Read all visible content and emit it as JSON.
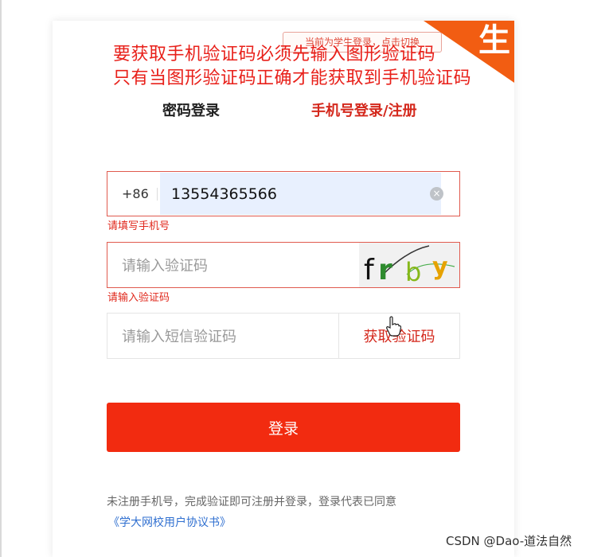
{
  "role_switch": {
    "text": "当前为学生登录，点击切换"
  },
  "corner_badge": {
    "text": "生",
    "color": "#f25d12"
  },
  "annotation": {
    "line1": "要获取手机验证码必须先输入图形验证码",
    "line2": "只有当图形验证码正确才能获取到手机验证码"
  },
  "tabs": {
    "password_login": "密码登录",
    "phone_login": "手机号登录/注册"
  },
  "phone_field": {
    "country_code": "+86",
    "value": "13554365566",
    "error": "请填写手机号"
  },
  "captcha_field": {
    "placeholder": "请输入验证码",
    "error": "请输入验证码",
    "captcha_text": "frby"
  },
  "sms_field": {
    "placeholder": "请输入短信验证码",
    "button": "获取验证码"
  },
  "login_button": "登录",
  "footer": {
    "note": "未注册手机号，完成验证即可注册并登录，登录代表已同意",
    "agreement": "《学大网校用户协议书》"
  },
  "watermark": "CSDN @Dao-道法自然",
  "colors": {
    "accent": "#f22b10",
    "error": "#e0281c",
    "link": "#2f6fd0"
  }
}
